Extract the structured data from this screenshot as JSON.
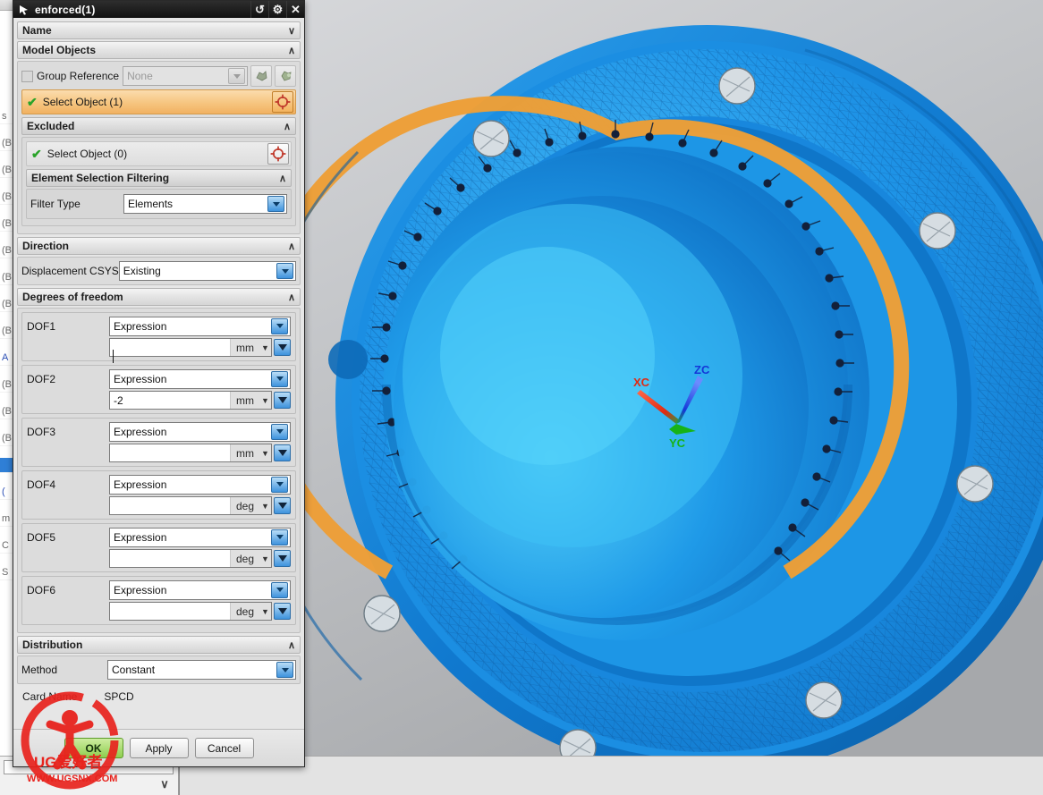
{
  "window": {
    "title": "enforced(1)",
    "app_icon": "cursor-arrow-icon",
    "buttons": [
      {
        "name": "reset",
        "glyph": "↺"
      },
      {
        "name": "settings",
        "glyph": "⚙"
      },
      {
        "name": "close",
        "glyph": "✕"
      }
    ]
  },
  "sections": {
    "name": {
      "label": "Name",
      "chevron": "∨",
      "expanded": false
    },
    "model_objects": {
      "label": "Model Objects",
      "chevron": "∧",
      "expanded": true
    },
    "excluded": {
      "label": "Excluded",
      "chevron": "∧",
      "expanded": true
    },
    "element_selection_filtering": {
      "label": "Element Selection Filtering",
      "chevron": "∧",
      "expanded": true
    },
    "direction": {
      "label": "Direction",
      "chevron": "∧",
      "expanded": true
    },
    "degrees_of_freedom": {
      "label": "Degrees of freedom",
      "chevron": "∧",
      "expanded": true
    },
    "distribution": {
      "label": "Distribution",
      "chevron": "∧",
      "expanded": true
    }
  },
  "model_objects": {
    "group_reference": {
      "label": "Group Reference",
      "checked": false,
      "value": "None",
      "disabled": true,
      "tool_buttons": [
        "select-group-icon",
        "select-region-icon"
      ]
    },
    "select_object": {
      "label": "Select Object (1)",
      "check_glyph": "✔",
      "target_icon": "crosshair-target-icon",
      "active": true
    }
  },
  "excluded": {
    "select_object": {
      "label": "Select Object (0)",
      "check_glyph": "✔",
      "target_icon": "crosshair-target-icon",
      "active": false
    },
    "filter_type": {
      "label": "Filter Type",
      "value": "Elements"
    }
  },
  "direction": {
    "displacement_csys": {
      "label": "Displacement CSYS",
      "value": "Existing"
    }
  },
  "dof": [
    {
      "label": "DOF1",
      "type": "Expression",
      "value": "",
      "unit": "mm",
      "focused": true
    },
    {
      "label": "DOF2",
      "type": "Expression",
      "value": "-2",
      "unit": "mm",
      "focused": false
    },
    {
      "label": "DOF3",
      "type": "Expression",
      "value": "",
      "unit": "mm",
      "focused": false
    },
    {
      "label": "DOF4",
      "type": "Expression",
      "value": "",
      "unit": "deg",
      "focused": false
    },
    {
      "label": "DOF5",
      "type": "Expression",
      "value": "",
      "unit": "deg",
      "focused": false
    },
    {
      "label": "DOF6",
      "type": "Expression",
      "value": "",
      "unit": "deg",
      "focused": false
    }
  ],
  "distribution": {
    "method": {
      "label": "Method",
      "value": "Constant"
    }
  },
  "card_name": {
    "label": "Card Name",
    "value": "SPCD"
  },
  "footer": {
    "ok": "OK",
    "apply": "Apply",
    "cancel": "Cancel"
  },
  "viewport": {
    "csys": {
      "x_label": "XC",
      "x_color": "#e02a12",
      "y_label": "YC",
      "y_color": "#17b317",
      "z_label": "ZC",
      "z_color": "#1438d8"
    },
    "model": {
      "body_color": "#1683e0",
      "highlight_color": "#f5a83c",
      "marker_color": "#14213a",
      "background_top": "#d9dadc",
      "background_bottom": "#a9abae"
    }
  },
  "tree_panel": {
    "rows": [
      {
        "text": "s",
        "style": "plain"
      },
      {
        "text": "(B",
        "style": "plain"
      },
      {
        "text": "(B",
        "style": "plain"
      },
      {
        "text": "(B",
        "style": "plain"
      },
      {
        "text": "(B",
        "style": "plain"
      },
      {
        "text": "(B",
        "style": "plain"
      },
      {
        "text": "(B",
        "style": "plain"
      },
      {
        "text": "(B",
        "style": "plain"
      },
      {
        "text": "(B",
        "style": "plain"
      },
      {
        "text": "A",
        "style": "blue"
      },
      {
        "text": "(B",
        "style": "plain"
      },
      {
        "text": "(B",
        "style": "plain"
      },
      {
        "text": "(B",
        "style": "plain"
      },
      {
        "text": "",
        "style": "sel"
      },
      {
        "text": "(",
        "style": "blue"
      },
      {
        "text": "m",
        "style": "plain"
      },
      {
        "text": "C",
        "style": "plain"
      },
      {
        "text": "S",
        "style": "plain"
      }
    ],
    "bottom_chevron": "∨"
  },
  "watermark": {
    "brand": "UG爱好者",
    "url": "WWW.UGSNX.COM"
  }
}
